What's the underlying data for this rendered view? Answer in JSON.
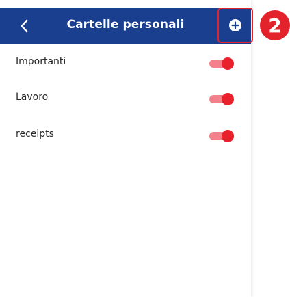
{
  "header": {
    "title": "Cartelle personali",
    "back_icon": "chevron-left-icon",
    "add_icon": "plus-circle-icon",
    "background_color": "#1a3f8f"
  },
  "annotation": {
    "step_number": "2",
    "color": "#e3232c"
  },
  "folders": [
    {
      "label": "Importanti",
      "enabled": true
    },
    {
      "label": "Lavoro",
      "enabled": true
    },
    {
      "label": "receipts",
      "enabled": true
    }
  ],
  "toggle_colors": {
    "track_on": "#f3808a",
    "knob_on": "#e8212c"
  }
}
